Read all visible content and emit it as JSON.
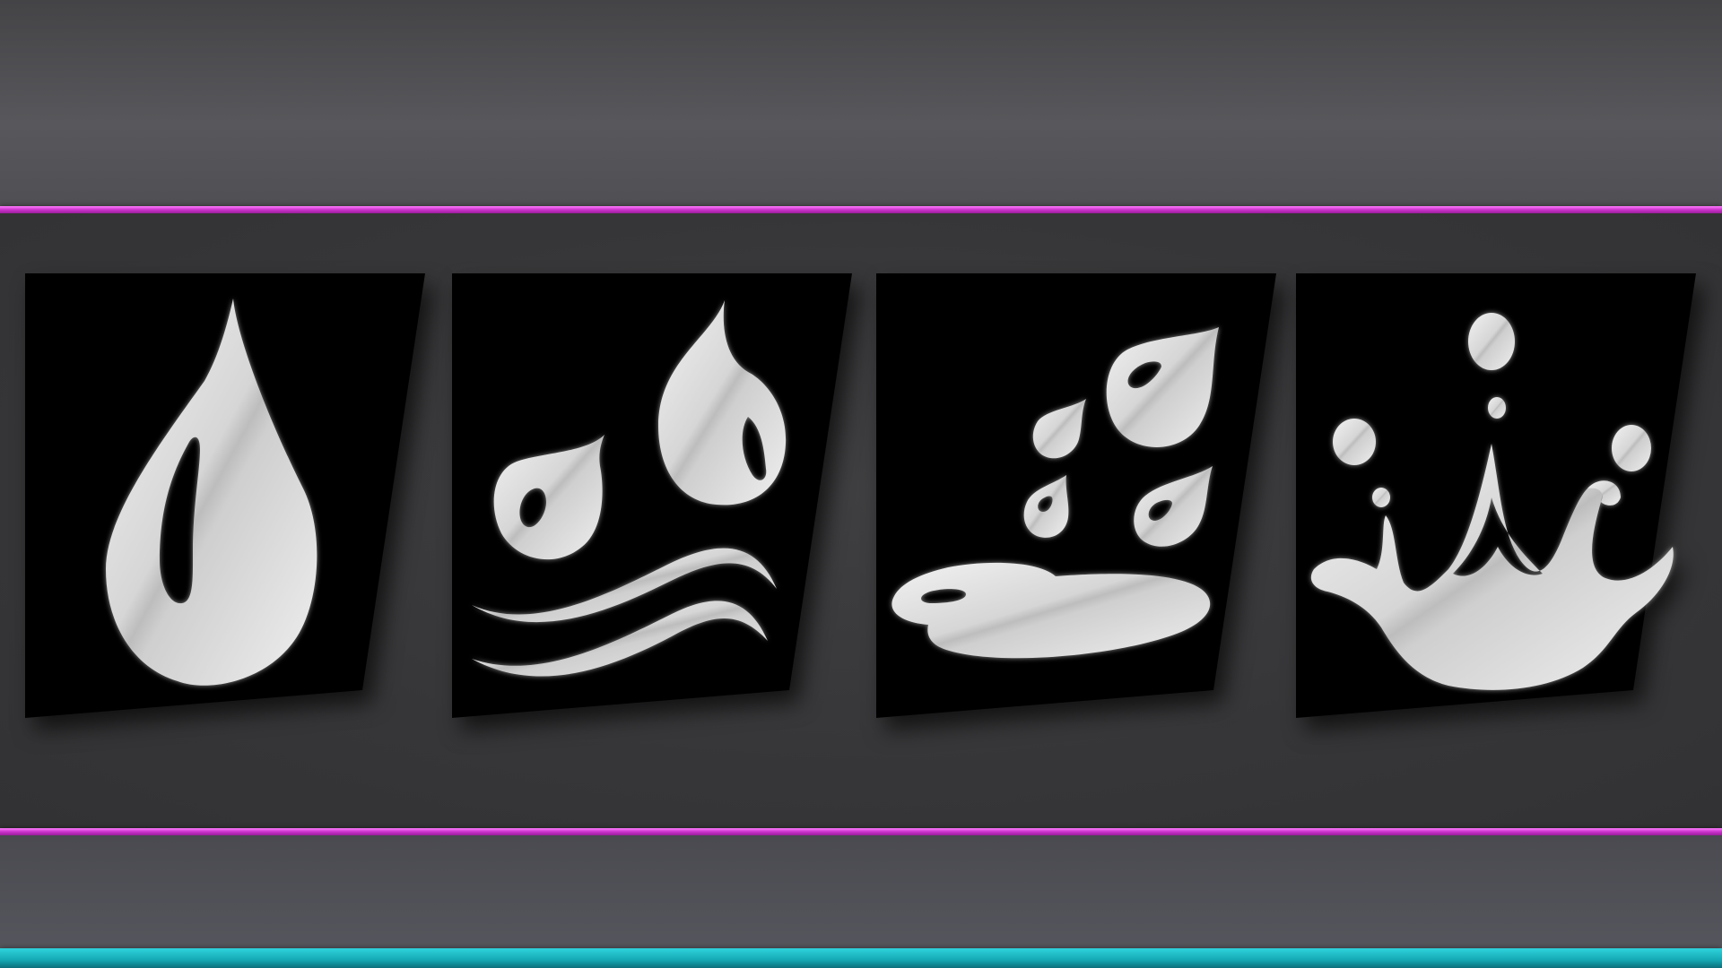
{
  "icons": [
    {
      "name": "water-drop-icon"
    },
    {
      "name": "drops-and-waves-icon"
    },
    {
      "name": "raindrops-puddle-icon"
    },
    {
      "name": "water-splash-icon"
    }
  ],
  "colors": {
    "background": "#3a3a3c",
    "tile": "#000000",
    "icon": "#d9d9d9",
    "stripe_magenta": "#cc33cc",
    "stripe_cyan": "#14a8b4"
  }
}
